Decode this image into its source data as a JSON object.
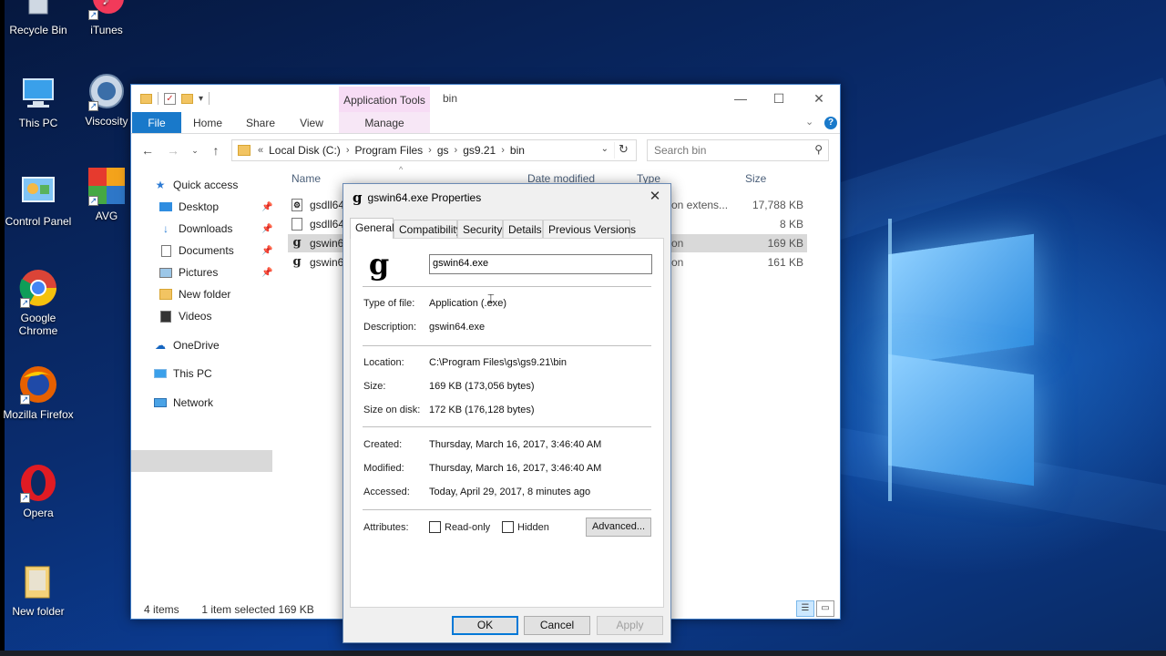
{
  "desktop": {
    "icons": [
      {
        "label": "Recycle Bin",
        "icon": "recycle-bin-icon"
      },
      {
        "label": "iTunes",
        "icon": "itunes-icon"
      },
      {
        "label": "This PC",
        "icon": "this-pc-icon"
      },
      {
        "label": "Viscosity",
        "icon": "viscosity-icon"
      },
      {
        "label": "Control Panel",
        "icon": "control-panel-icon"
      },
      {
        "label": "AVG",
        "icon": "avg-icon"
      },
      {
        "label": "Google Chrome",
        "icon": "chrome-icon"
      },
      {
        "label": "Mozilla Firefox",
        "icon": "firefox-icon"
      },
      {
        "label": "Opera",
        "icon": "opera-icon"
      },
      {
        "label": "New folder",
        "icon": "folder-icon"
      }
    ]
  },
  "explorer": {
    "context_tab_header": "Application Tools",
    "title": "bin",
    "ribbon_tabs": [
      "File",
      "Home",
      "Share",
      "View",
      "Manage"
    ],
    "breadcrumb": {
      "overflow": "«",
      "parts": [
        "Local Disk (C:)",
        "Program Files",
        "gs",
        "gs9.21",
        "bin"
      ]
    },
    "search_placeholder": "Search bin",
    "nav": {
      "quick_access": "Quick access",
      "items": [
        "Desktop",
        "Downloads",
        "Documents",
        "Pictures",
        "New folder",
        "Videos"
      ],
      "onedrive": "OneDrive",
      "this_pc": "This PC",
      "network": "Network"
    },
    "columns": {
      "name": "Name",
      "date_modified": "Date modified",
      "type": "Type",
      "size": "Size"
    },
    "files": [
      {
        "name": "gsdll64",
        "type": "tion extens...",
        "size": "17,788 KB"
      },
      {
        "name": "gsdll64",
        "type": "",
        "size": "8 KB"
      },
      {
        "name": "gswin6",
        "type": "tion",
        "size": "169 KB"
      },
      {
        "name": "gswin6",
        "type": "tion",
        "size": "161 KB"
      }
    ],
    "status": {
      "items": "4 items",
      "selected": "1 item selected  169 KB"
    }
  },
  "properties": {
    "title": "gswin64.exe Properties",
    "tabs": [
      "General",
      "Compatibility",
      "Security",
      "Details",
      "Previous Versions"
    ],
    "filename": "gswin64.exe",
    "labels": {
      "type": "Type of file:",
      "description": "Description:",
      "location": "Location:",
      "size": "Size:",
      "size_on_disk": "Size on disk:",
      "created": "Created:",
      "modified": "Modified:",
      "accessed": "Accessed:",
      "attributes": "Attributes:"
    },
    "values": {
      "type": "Application (.exe)",
      "description": "gswin64.exe",
      "location": "C:\\Program Files\\gs\\gs9.21\\bin",
      "size": "169 KB (173,056 bytes)",
      "size_on_disk": "172 KB (176,128 bytes)",
      "created": "Thursday, March 16, 2017, 3:46:40 AM",
      "modified": "Thursday, March 16, 2017, 3:46:40 AM",
      "accessed": "Today, April 29, 2017, 8 minutes ago"
    },
    "attributes": {
      "readonly": "Read-only",
      "hidden": "Hidden",
      "advanced": "Advanced..."
    },
    "buttons": {
      "ok": "OK",
      "cancel": "Cancel",
      "apply": "Apply"
    }
  }
}
